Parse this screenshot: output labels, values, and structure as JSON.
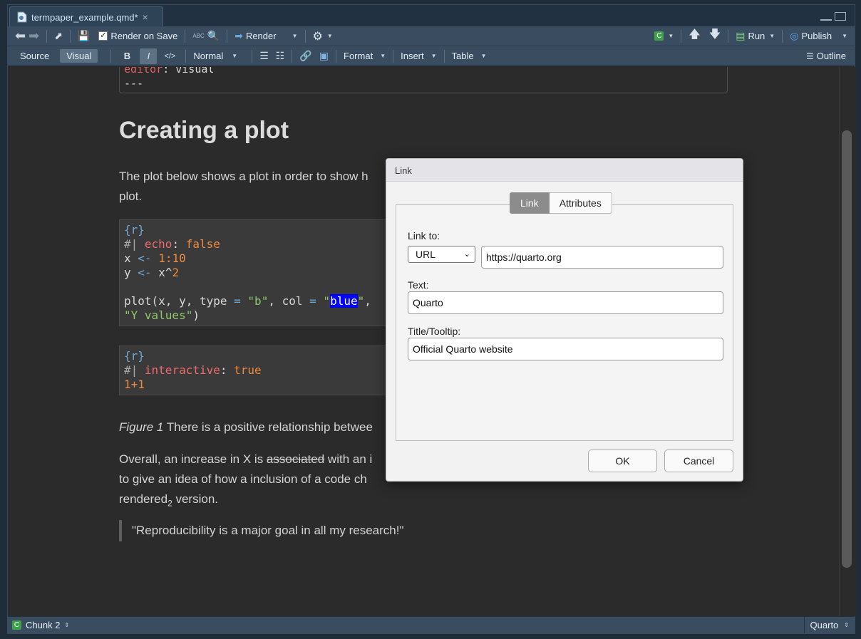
{
  "tab": {
    "filename": "termpaper_example.qmd*",
    "close": "×"
  },
  "toolbar1": {
    "render_on_save": "Render on Save",
    "render": "Render",
    "run": "Run",
    "publish": "Publish",
    "abc": "ABC"
  },
  "toolbar2": {
    "source": "Source",
    "visual": "Visual",
    "bold": "B",
    "italic": "I",
    "code": "</>",
    "style": "Normal",
    "format": "Format",
    "insert": "Insert",
    "table": "Table",
    "outline": "Outline"
  },
  "document": {
    "yaml_line1_key": "editor",
    "yaml_line1_value": ": visual",
    "yaml_line2": "---",
    "heading": "Creating a plot",
    "para1_line1": "The plot below shows a plot in order to show h",
    "para1_line2": "plot.",
    "code1": {
      "header": "{r}",
      "l2_prefix": "#|",
      "l2_key": "echo",
      "l2_colon": ":",
      "l2_val": "false",
      "l3_a": "x",
      "l3_op": "<-",
      "l3_val": "1:10",
      "l4_a": "y",
      "l4_op": "<-",
      "l4_b": "x^",
      "l4_val": "2",
      "l5_a": "plot(x, y, type",
      "l5_eq": "=",
      "l5_str1": "\"b\"",
      "l5_b": ", col",
      "l5_eq2": "=",
      "l5_q": "\"",
      "l5_sel": "blue",
      "l5_q2": "\"",
      "l5_c": ",",
      "l6_str": "\"Y values\"",
      "l6_end": ")"
    },
    "code2": {
      "header": "{r}",
      "l2_prefix": "#|",
      "l2_key": "interactive",
      "l2_colon": ":",
      "l2_val": "true",
      "l3": "1+1"
    },
    "figure_label": "Figure 1",
    "figure_text": " There is a positive relationship betwee",
    "para2_a": "Overall, an increase in X is ",
    "para2_strike": "associated",
    "para2_b": " with an i",
    "para2_line2": "to give an idea of how a inclusion of a code ch",
    "para2_line3_a": "rendered",
    "para2_sub": "2",
    "para2_line3_b": " version.",
    "quote": "\"Reproducibility is a major goal in all my research!\""
  },
  "statusbar": {
    "chunk": "Chunk 2",
    "chunk_icon": "C",
    "mode": "Quarto"
  },
  "dialog": {
    "title": "Link",
    "tab_link": "Link",
    "tab_attributes": "Attributes",
    "link_to_label": "Link to:",
    "link_type": "URL",
    "url": "https://quarto.org",
    "text_label": "Text:",
    "text_value": "Quarto",
    "title_label": "Title/Tooltip:",
    "title_value": "Official Quarto website",
    "ok": "OK",
    "cancel": "Cancel"
  }
}
